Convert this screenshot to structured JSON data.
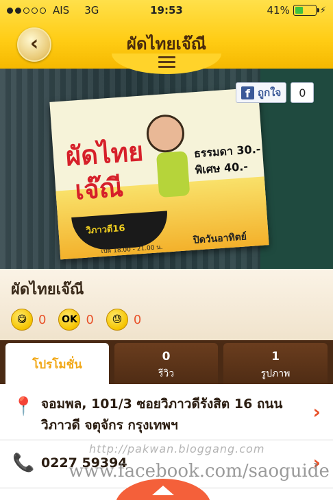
{
  "status_bar": {
    "carrier": "AIS",
    "network": "3G",
    "time": "19:53",
    "battery": "41%",
    "battery_level": 0.41
  },
  "nav": {
    "title": "ผัดไทยเจ๊ณี",
    "back_icon": "chevron-left-icon",
    "menu_icon": "hamburger-icon"
  },
  "facebook": {
    "like_label": "ถูกใจ",
    "like_count": "0"
  },
  "sign": {
    "line1": "ผัดไทย",
    "line2": "เจ๊ณี",
    "price1": "ธรรมดา 30.-",
    "price2": "พิเศษ 40.-",
    "location": "วิภาวดี16",
    "hours": "เปิด 18.00 - 21.00 น.",
    "closed": "ปิดวันอาทิตย์"
  },
  "place": {
    "name": "ผัดไทยเจ๊ณี",
    "reactions": [
      {
        "icon": "tongue-face-icon",
        "count": "0"
      },
      {
        "icon": "ok-face-icon",
        "label": "OK",
        "count": "0"
      },
      {
        "icon": "sad-face-icon",
        "count": "0"
      }
    ]
  },
  "tabs": [
    {
      "label": "โปรโมชั่น",
      "count": ""
    },
    {
      "label": "รีวิว",
      "count": "0"
    },
    {
      "label": "รูปภาพ",
      "count": "1"
    }
  ],
  "address": {
    "line1": "จอมพล, 101/3 ซอยวิภาวดีรังสิต 16 ถนน",
    "line2": "วิภาวดี จตุจักร กรุงเทพฯ"
  },
  "phone": "0227 59394",
  "watermark": {
    "blog": "http://pakwan.bloggang.com",
    "facebook": "www.facebook.com/saoguide"
  },
  "colors": {
    "header_yellow": "#ffcc14",
    "brown": "#4a2a14",
    "accent_orange": "#e8522a",
    "active_tab_text": "#f1a817"
  }
}
